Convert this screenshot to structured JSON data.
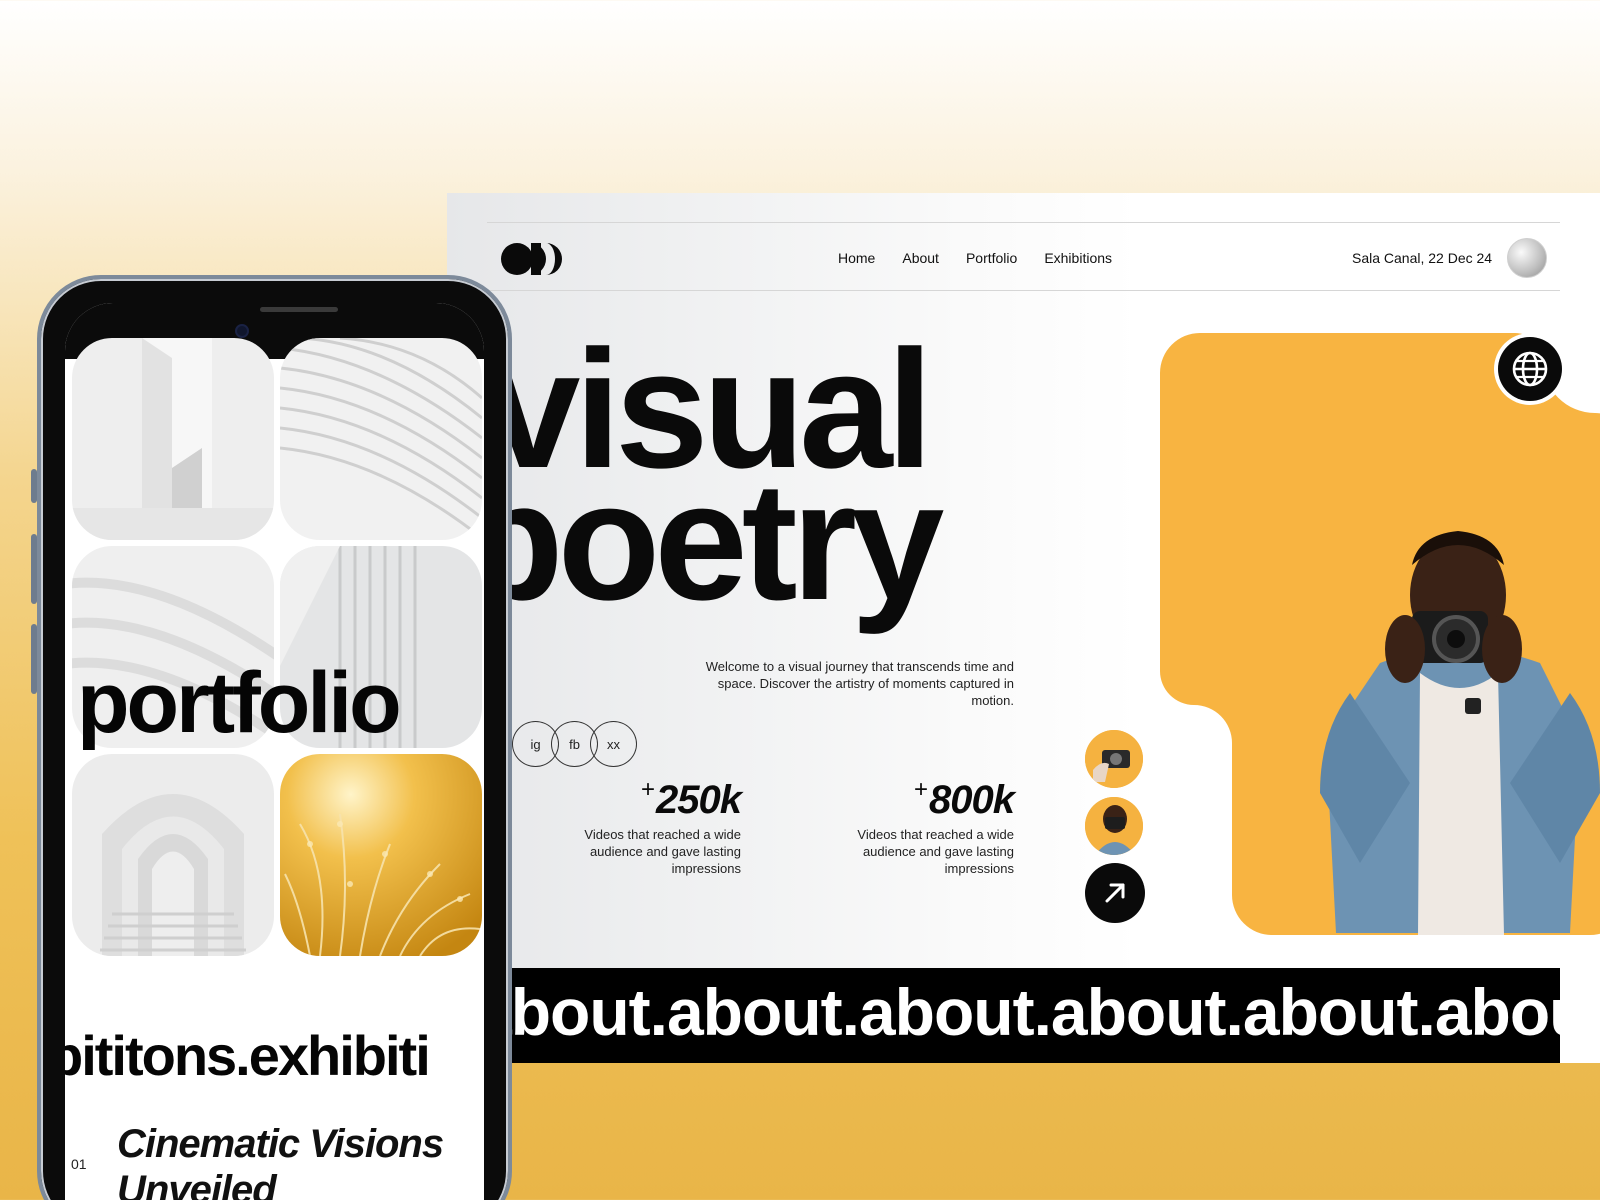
{
  "desktop": {
    "nav": {
      "items": [
        "Home",
        "About",
        "Portfolio",
        "Exhibitions"
      ]
    },
    "event_label": "Sala Canal, 22 Dec 24",
    "hero": {
      "line1": "visual",
      "line2": "poetry",
      "intro": "Welcome to a visual journey that transcends time and space. Discover the artistry of moments captured in motion."
    },
    "socials": [
      "ig",
      "fb",
      "xx"
    ],
    "stats": [
      {
        "prefix": "+",
        "value": "250k",
        "description": "Videos that reached a wide audience and gave lasting impressions"
      },
      {
        "prefix": "+",
        "value": "800k",
        "description": "Videos that reached a wide audience and gave lasting impressions"
      }
    ],
    "marquee_text": "about.about.about.about.about.about.",
    "icons": {
      "globe": "globe-icon",
      "arrow": "arrow-up-right-icon"
    },
    "colors": {
      "accent_orange": "#f8b441",
      "ink": "#0a0a0a"
    }
  },
  "phone": {
    "portfolio_word": "portfolio",
    "exhibitions_marquee": "bititons.exhibiti",
    "item_number": "01",
    "headline": "Cinematic Visions Unveiled"
  }
}
